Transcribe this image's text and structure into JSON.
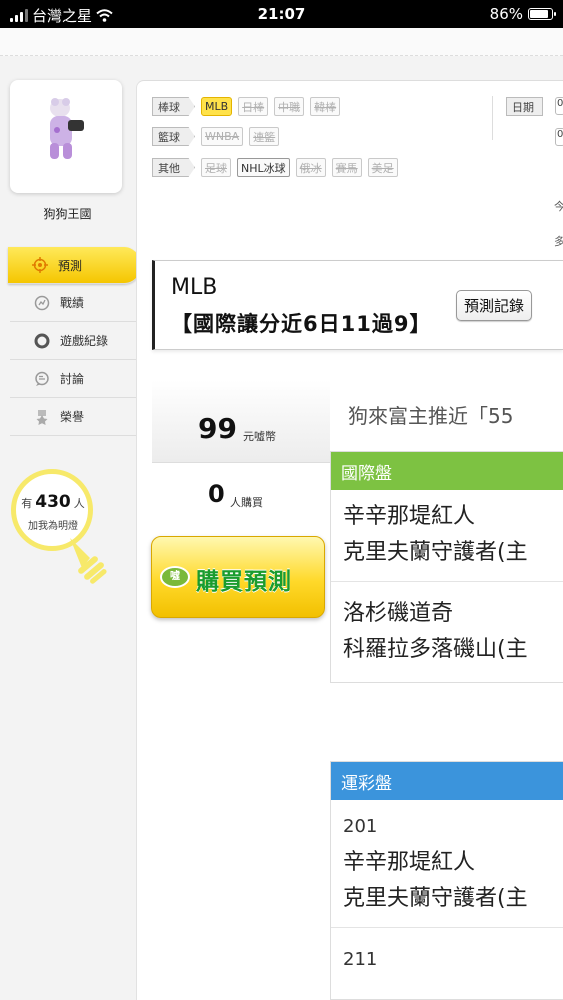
{
  "status_bar": {
    "carrier": "台灣之星",
    "time": "21:07",
    "battery": "86%",
    "battery_level": 0.86
  },
  "profile": {
    "name": "狗狗王國"
  },
  "nav": [
    {
      "label": "預測",
      "icon": "crosshair-icon",
      "active": true
    },
    {
      "label": "戰績",
      "icon": "chart-icon"
    },
    {
      "label": "遊戲紀錄",
      "icon": "record-icon"
    },
    {
      "label": "討論",
      "icon": "chat-icon"
    },
    {
      "label": "榮譽",
      "icon": "medal-icon"
    }
  ],
  "fans": {
    "prefix": "有",
    "count": "430",
    "suffix": "人",
    "subtitle": "加我為明燈"
  },
  "filters": {
    "baseball": {
      "label": "棒球",
      "items": [
        "MLB",
        "日棒",
        "中職",
        "韓棒"
      ]
    },
    "basketball": {
      "label": "籃球",
      "items": [
        "WNBA",
        "連籃"
      ]
    },
    "other": {
      "label": "其他",
      "items": [
        "足球",
        "NHL冰球",
        "俄冰",
        "賽馬",
        "美足"
      ]
    }
  },
  "date_label": "日期",
  "right_cut": {
    "a": "0",
    "b": "0",
    "c": "今",
    "d": "多"
  },
  "title": {
    "line1": "MLB",
    "line2": "【國際讓分近6日11過9】",
    "record_button": "預測記錄"
  },
  "price": {
    "value": "99",
    "unit": "元噓幣"
  },
  "buyers": {
    "value": "0",
    "unit": "人購買"
  },
  "buy_button": {
    "label": "購買預測",
    "coin": "噓"
  },
  "headline": "狗來富主推近「55",
  "international": {
    "header": "國際盤",
    "matches": [
      {
        "team1": "辛辛那堤紅人",
        "team2": "克里夫蘭守護者(主"
      },
      {
        "team1": "洛杉磯道奇",
        "team2": "科羅拉多落磯山(主"
      }
    ]
  },
  "sportslottery": {
    "header": "運彩盤",
    "matches": [
      {
        "code": "201",
        "team1": "辛辛那堤紅人",
        "team2": "克里夫蘭守護者(主"
      },
      {
        "code": "211"
      }
    ]
  }
}
